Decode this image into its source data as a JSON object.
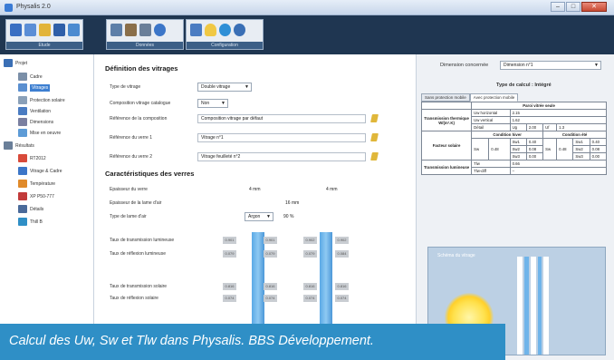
{
  "window": {
    "title": "Physalis 2.0",
    "buttons": [
      "–",
      "□",
      "✕"
    ]
  },
  "ribbon": {
    "groups": [
      {
        "label": "Etude",
        "icons": [
          "new-icon",
          "open-icon",
          "folder-icon",
          "save-icon",
          "export-icon"
        ]
      },
      {
        "label": "Données",
        "icons": [
          "print-icon",
          "list-icon",
          "copy-icon",
          "help-icon"
        ]
      },
      {
        "label": "Configuration",
        "icons": [
          "window-icon",
          "bulb-icon",
          "globe-icon",
          "settings-icon"
        ]
      }
    ]
  },
  "nav": {
    "items": [
      {
        "label": "Projet",
        "level": 0,
        "icon_color": "#3a6fb5"
      },
      {
        "label": "Cadre",
        "level": 1,
        "icon_color": "#7b8fa8"
      },
      {
        "label": "Vitrages",
        "level": 1,
        "icon_color": "#5a8fd0",
        "selected": true
      },
      {
        "label": "Protection solaire",
        "level": 1,
        "icon_color": "#8aa0b8"
      },
      {
        "label": "Ventilation",
        "level": 1,
        "icon_color": "#4a7cc2"
      },
      {
        "label": "Dimensions",
        "level": 1,
        "icon_color": "#7a7fa0"
      },
      {
        "label": "Mise en oeuvre",
        "level": 1,
        "icon_color": "#5d9bd6"
      },
      {
        "label": "Résultats",
        "level": 0,
        "icon_color": "#6a7f99"
      },
      {
        "label": "RT2012",
        "level": 1,
        "icon_color": "#d84a3a"
      },
      {
        "label": "Vitrage & Cadre",
        "level": 1,
        "icon_color": "#3c76c8"
      },
      {
        "label": "Température",
        "level": 1,
        "icon_color": "#e08a2a"
      },
      {
        "label": "XP P50-777",
        "level": 1,
        "icon_color": "#c23a3a"
      },
      {
        "label": "Détails",
        "level": 1,
        "icon_color": "#4a6a9a"
      },
      {
        "label": "Thill B",
        "level": 1,
        "icon_color": "#2f8fc6"
      }
    ]
  },
  "main": {
    "section1_title": "Définition des vitrages",
    "type_vitrage_label": "Type de vitrage",
    "type_vitrage_value": "Double vitrage",
    "catalogue_label": "Composition vitrage catalogue",
    "catalogue_value": "Non",
    "ref_composition_label": "Référence de la composition",
    "ref_composition_value": "Composition vitrage par défaut",
    "ref_verre1_label": "Référence du verre 1",
    "ref_verre1_value": "Vitrage n°1",
    "ref_verre2_label": "Référence du verre 2",
    "ref_verre2_value": "Vitrage feuilleté n°2",
    "section2_title": "Caractéristiques des verres",
    "epaisseur_label": "Epaisseur du verre",
    "epaisseur_v1": "4 mm",
    "epaisseur_v2": "4 mm",
    "lame_label": "Epaisseur de la lame d'air",
    "lame_value": "16 mm",
    "gaz_label": "Type de lame d'air",
    "gaz_value": "Argon",
    "gaz_pct": "90 %",
    "tl_label": "Taux de transmission lumineuse",
    "rl_label": "Taux de réflexion lumineuse",
    "ts_label": "Taux de transmission solaire",
    "rs_label": "Taux de réflexion solaire",
    "grid_rows": [
      [
        "0.901",
        "0.901",
        "0.902",
        "0.902"
      ],
      [
        "0.079",
        "0.079",
        "0.079",
        "0.084"
      ],
      [
        "0.816",
        "0.816",
        "0.816",
        "0.816"
      ],
      [
        "0.074",
        "0.074",
        "0.074",
        "0.074"
      ]
    ]
  },
  "right": {
    "dimension_label": "Dimension concernée",
    "dimension_value": "Dimension n°1",
    "calc_type": "Type de calcul : Intégré",
    "tabs": [
      "Sans protection mobile",
      "Avec protection mobile"
    ],
    "table": {
      "paroi_header": "Paroi vitrée seule",
      "transmission_thermique": "Transmission thermique",
      "uw_unit": "W/(m².K)",
      "uw_h_label": "Uw horizontal",
      "uw_h": "2.15",
      "uw_v_label": "Uw vertical",
      "uw_v": "1.62",
      "detail_label": "Détail",
      "ug_label": "Ug",
      "ug": "2.00",
      "uf_label": "Uf",
      "uf": "1.3",
      "facteur_solaire": "Facteur solaire",
      "hiver": "Condition hiver",
      "ete": "Condition été",
      "sw_label": "Sw",
      "sw_hiver": "0.48",
      "sw_ete": "0.48",
      "sw1_label": "Sw1",
      "sw2_label": "Sw2",
      "sw3_label": "Sw3",
      "sw1_hiver": "0.40",
      "sw2_hiver": "0.08",
      "sw3_hiver": "0.00",
      "sw1_ete": "0.40",
      "sw2_ete": "0.08",
      "sw3_ete": "0.00",
      "transmission_lumineuse": "Transmission lumineuse",
      "tlw_label": "Tlw",
      "tlw": "0.66",
      "tlw_diff_label": "Tlw-diff",
      "tlw_diff": "–"
    },
    "schema_title": "Schéma du vitrage"
  },
  "caption": "Calcul des Uw, Sw et Tlw dans Physalis. BBS Développement."
}
